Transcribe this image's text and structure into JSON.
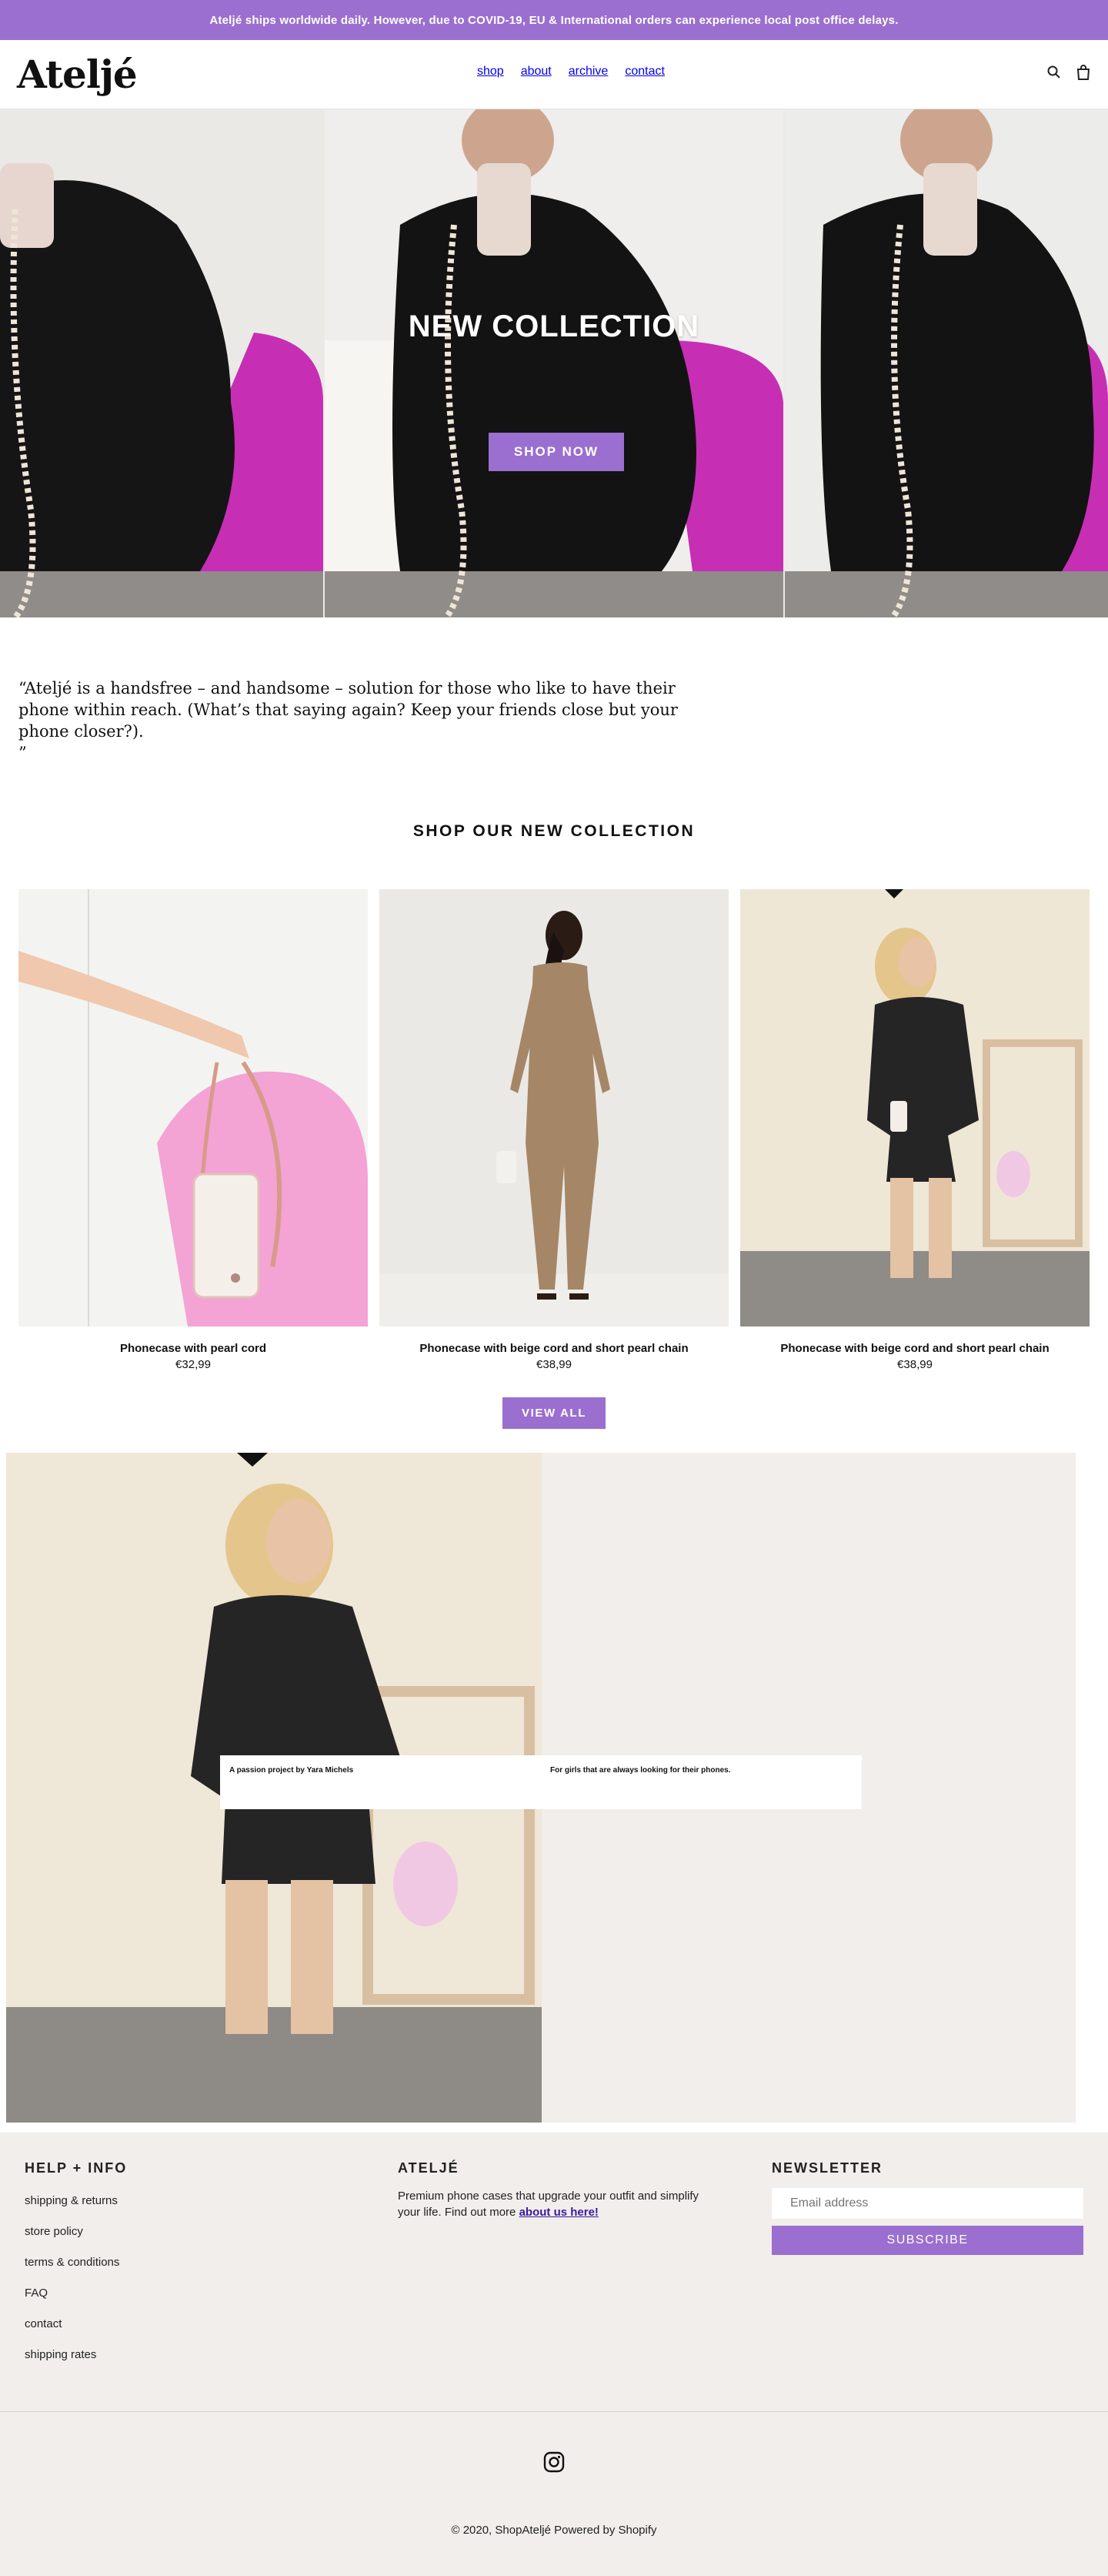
{
  "announcement": "Ateljé ships worldwide daily. However, due to COVID-19, EU & International orders can experience local post office delays.",
  "brand": {
    "logo": "Ateljé",
    "accent": "#9b6fcf"
  },
  "nav": {
    "items": [
      "shop",
      "about",
      "archive",
      "contact"
    ]
  },
  "header_icons": [
    "search-icon",
    "cart-icon"
  ],
  "hero": {
    "title": "NEW COLLECTION",
    "button": "SHOP NOW"
  },
  "quote": "“Ateljé is a handsfree – and handsome – solution for those who like to have their phone within reach. (What’s that saying again? Keep your friends close but your phone closer?).\n”",
  "collection": {
    "title": "SHOP OUR NEW COLLECTION",
    "products": [
      {
        "name": "Phonecase with pearl cord",
        "price": "€32,99"
      },
      {
        "name": "Phonecase with beige cord and short pearl chain",
        "price": "€38,99"
      },
      {
        "name": "Phonecase with beige cord and short pearl chain",
        "price": "€38,99"
      }
    ],
    "view_all": "VIEW ALL"
  },
  "feature": {
    "left_text": "A passion project by Yara Michels",
    "right_text": "For girls that are always looking for their phones."
  },
  "footer": {
    "help_title": "HELP + INFO",
    "help_links": [
      "shipping & returns",
      "store policy",
      "terms & conditions",
      "FAQ",
      "contact",
      "shipping rates"
    ],
    "about_title": "ATELJÉ",
    "about_text": "Premium phone cases that upgrade your outfit and simplify your life. Find out more ",
    "about_link": "about us here!",
    "newsletter_title": "NEWSLETTER",
    "email_placeholder": "Email address",
    "subscribe": "SUBSCRIBE",
    "social_icon": "instagram-icon",
    "copyright": "© 2020, ShopAteljé Powered by Shopify"
  }
}
